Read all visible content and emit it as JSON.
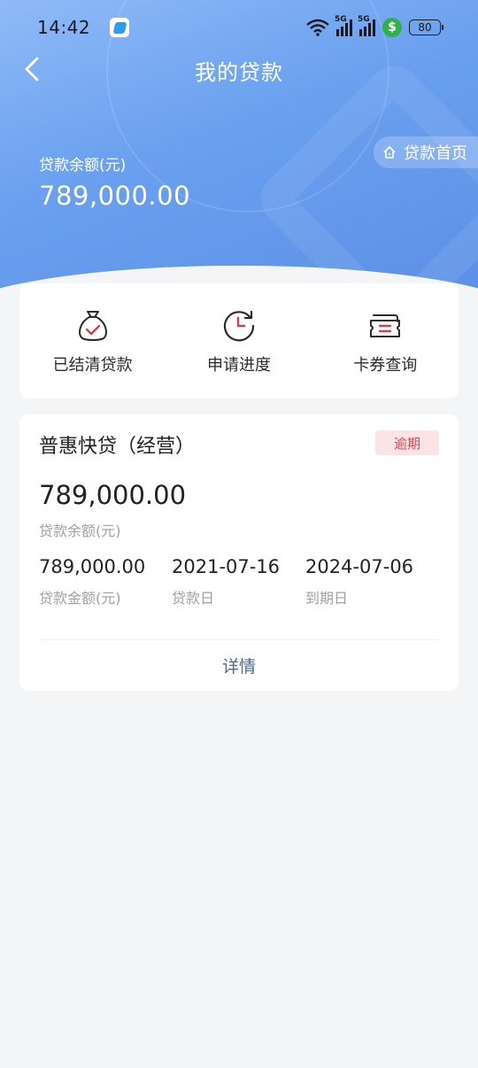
{
  "status_bar": {
    "time": "14:42",
    "signal_1": "5G",
    "signal_2": "5G",
    "pay_symbol": "$",
    "battery": "80"
  },
  "header": {
    "title": "我的贷款",
    "home_link": "贷款首页",
    "balance_label": "贷款余额(元)",
    "balance_value": "789,000.00"
  },
  "quick_actions": [
    {
      "label": "已结清贷款",
      "icon": "money-bag-check-icon"
    },
    {
      "label": "申请进度",
      "icon": "clock-refresh-icon"
    },
    {
      "label": "卡券查询",
      "icon": "coupon-icon"
    }
  ],
  "loan": {
    "name": "普惠快贷（经营）",
    "status": "逾期",
    "balance": "789,000.00",
    "balance_label": "贷款余额(元)",
    "amount": "789,000.00",
    "amount_label": "贷款金额(元)",
    "start_date": "2021-07-16",
    "start_label": "贷款日",
    "due_date": "2024-07-06",
    "due_label": "到期日",
    "detail_label": "详情"
  },
  "colors": {
    "header_blue": "#6aa0ef",
    "icon_red": "#c8444f",
    "overdue_bg": "#fbe3e6",
    "overdue_text": "#d44a57",
    "link_blue": "#3f6d9e"
  }
}
